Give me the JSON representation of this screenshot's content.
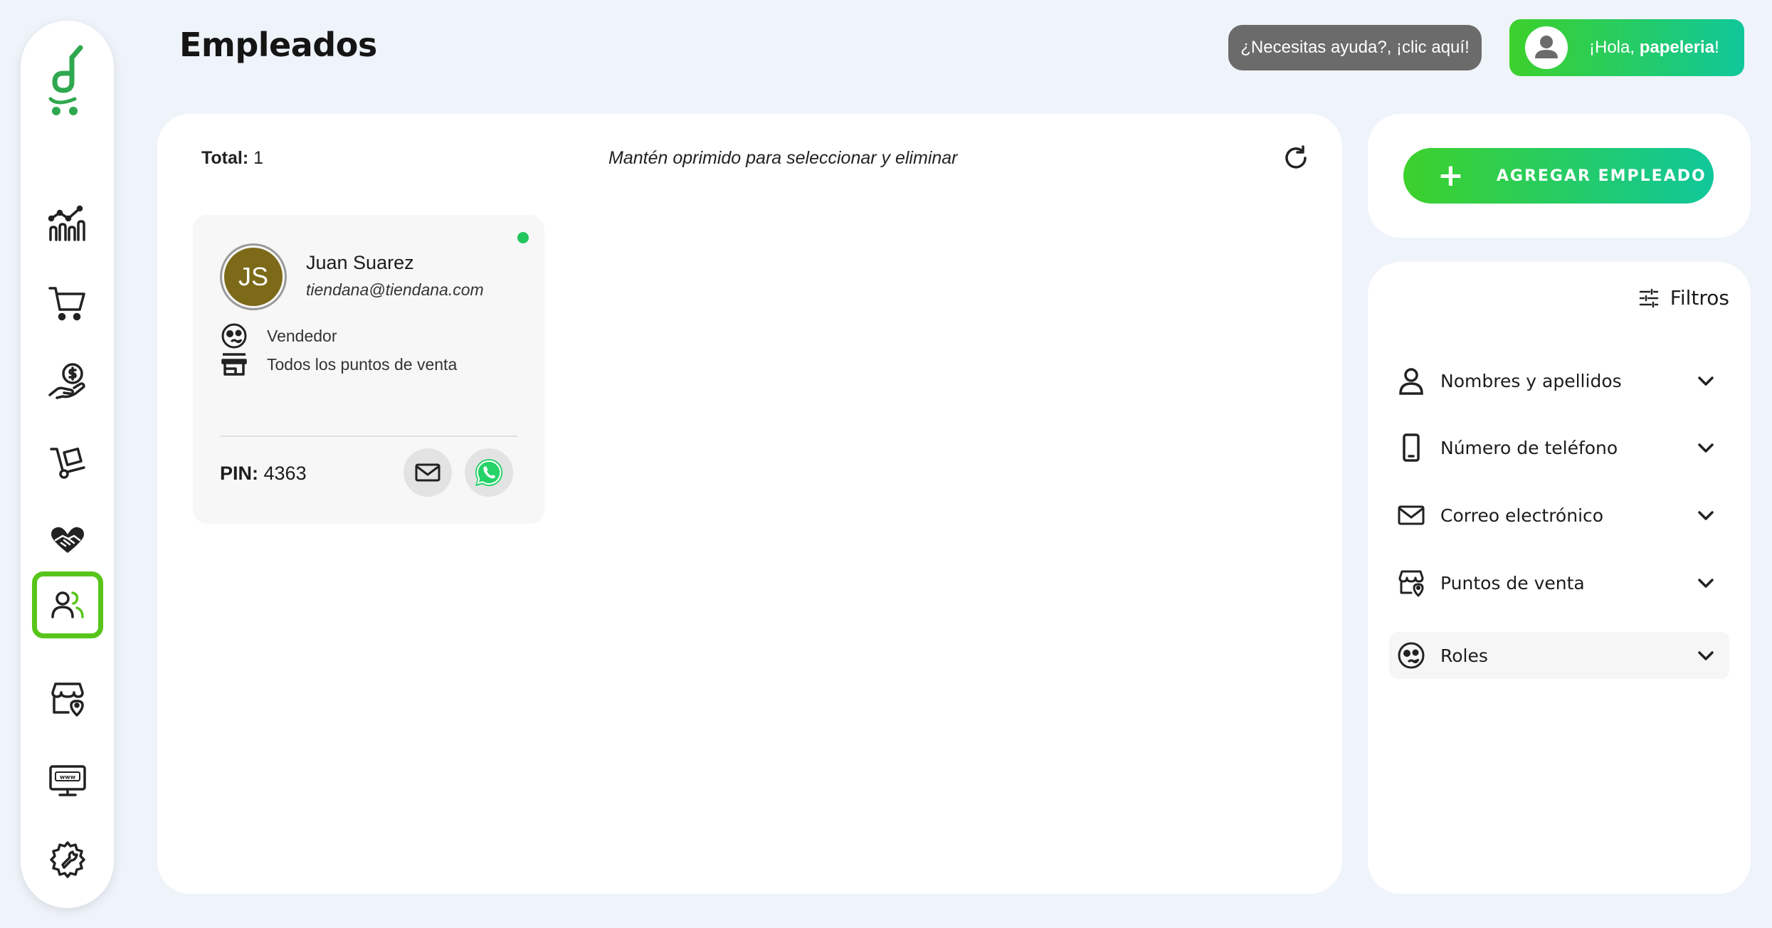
{
  "header": {
    "title": "Empleados",
    "help_label": "¿Necesitas ayuda?, ¡clic aquí!",
    "greeting_prefix": "¡Hola, ",
    "user_name": "papeleria",
    "greeting_suffix": "!"
  },
  "sidebar": {
    "items": [
      {
        "name": "dashboard",
        "icon": "chart-icon"
      },
      {
        "name": "sales",
        "icon": "cart-icon"
      },
      {
        "name": "finance",
        "icon": "money-hand-icon"
      },
      {
        "name": "inventory",
        "icon": "hand-truck-icon"
      },
      {
        "name": "clients",
        "icon": "handshake-heart-icon"
      },
      {
        "name": "employees",
        "icon": "users-icon",
        "active": true
      },
      {
        "name": "stores",
        "icon": "store-location-icon"
      },
      {
        "name": "website",
        "icon": "www-monitor-icon"
      },
      {
        "name": "settings",
        "icon": "gear-wrench-icon"
      }
    ],
    "accent": "#58c51b"
  },
  "list": {
    "total_label": "Total:",
    "total_value": "1",
    "hint": "Mantén oprimido para seleccionar y eliminar"
  },
  "employee": {
    "initials": "JS",
    "name": "Juan Suarez",
    "email": "tiendana@tiendana.com",
    "role": "Vendedor",
    "stores": "Todos los puntos de venta",
    "pin_label": "PIN:",
    "pin_value": "4363",
    "status_color": "#22c55e",
    "avatar_color": "#7c6a19"
  },
  "actions": {
    "add_label": "AGREGAR EMPLEADO",
    "add_icon": "+"
  },
  "filters": {
    "title": "Filtros",
    "items": [
      {
        "label": "Nombres y apellidos",
        "icon": "person-icon"
      },
      {
        "label": "Número de teléfono",
        "icon": "phone-icon"
      },
      {
        "label": "Correo electrónico",
        "icon": "mail-icon"
      },
      {
        "label": "Puntos de venta",
        "icon": "store-location-icon"
      },
      {
        "label": "Roles",
        "icon": "role-icon"
      }
    ]
  },
  "colors": {
    "brand_gradient_start": "#3dd12b",
    "brand_gradient_end": "#10c79a",
    "background": "#eff3fa"
  }
}
